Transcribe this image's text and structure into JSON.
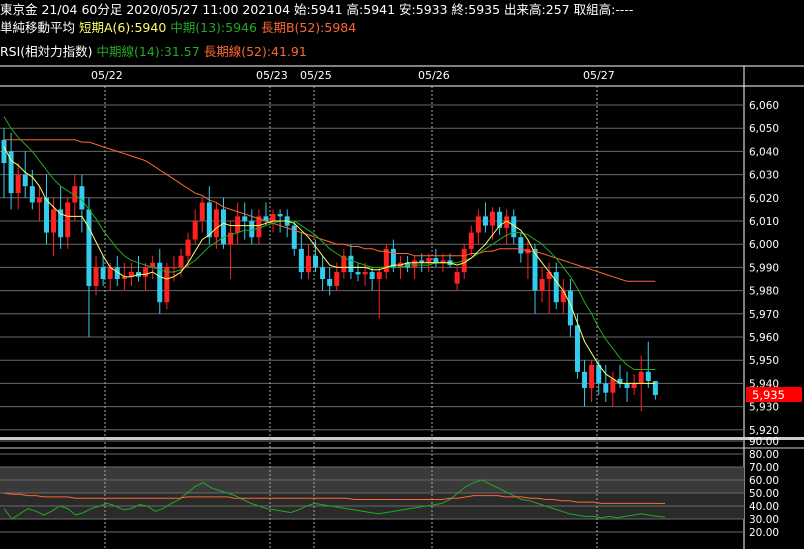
{
  "header": {
    "line1": "東京金 21/04 60分足 2020/05/27 11:00 202104 始:5941 高:5941 安:5933 終:5935 出来高:257 取組高:----",
    "ma_title": "単純移動平均",
    "ma_short": "短期A(6):5940",
    "ma_mid": "中期(13):5946",
    "ma_long": "長期B(52):5984",
    "rsi_title": "RSI(相対力指数)",
    "rsi_mid": "中期線(14):31.57",
    "rsi_long": "長期線(52):41.91"
  },
  "colors": {
    "up": "#ff2222",
    "down": "#33ccee",
    "ma_short": "#ffff66",
    "ma_mid": "#22aa22",
    "ma_long": "#ff6633",
    "last_price_bg": "#ff0000"
  },
  "chart_data": [
    {
      "type": "candlestick",
      "title": "東京金 21/04 60分足",
      "x_labels": [
        "05/22",
        "05/23",
        "05/25",
        "05/26",
        "05/27"
      ],
      "ylim": [
        5920,
        6070
      ],
      "y_ticks": [
        "6,060",
        "6,050",
        "6,040",
        "6,030",
        "6,020",
        "6,010",
        "6,000",
        "5,990",
        "5,980",
        "5,970",
        "5,960",
        "5,950",
        "5,940",
        "5,930",
        "5,920"
      ],
      "last_price_label": "5,935",
      "grid": true,
      "candles": [
        {
          "o": 6045,
          "h": 6050,
          "l": 6020,
          "c": 6035
        },
        {
          "o": 6040,
          "h": 6048,
          "l": 6015,
          "c": 6022
        },
        {
          "o": 6022,
          "h": 6035,
          "l": 6015,
          "c": 6030
        },
        {
          "o": 6030,
          "h": 6040,
          "l": 6020,
          "c": 6025
        },
        {
          "o": 6025,
          "h": 6032,
          "l": 6015,
          "c": 6018
        },
        {
          "o": 6018,
          "h": 6025,
          "l": 6010,
          "c": 6020
        },
        {
          "o": 6020,
          "h": 6030,
          "l": 6000,
          "c": 6005
        },
        {
          "o": 6005,
          "h": 6020,
          "l": 5995,
          "c": 6015
        },
        {
          "o": 6015,
          "h": 6025,
          "l": 5998,
          "c": 6003
        },
        {
          "o": 6003,
          "h": 6020,
          "l": 5998,
          "c": 6018
        },
        {
          "o": 6018,
          "h": 6030,
          "l": 6010,
          "c": 6025
        },
        {
          "o": 6025,
          "h": 6030,
          "l": 6005,
          "c": 6015
        },
        {
          "o": 6015,
          "h": 6020,
          "l": 5960,
          "c": 5982
        },
        {
          "o": 5982,
          "h": 5995,
          "l": 5978,
          "c": 5990
        },
        {
          "o": 5990,
          "h": 5995,
          "l": 5982,
          "c": 5985
        },
        {
          "o": 5985,
          "h": 5992,
          "l": 5980,
          "c": 5990
        },
        {
          "o": 5990,
          "h": 5995,
          "l": 5982,
          "c": 5985
        },
        {
          "o": 5985,
          "h": 5992,
          "l": 5980,
          "c": 5986
        },
        {
          "o": 5986,
          "h": 5992,
          "l": 5982,
          "c": 5988
        },
        {
          "o": 5988,
          "h": 5995,
          "l": 5984,
          "c": 5986
        },
        {
          "o": 5986,
          "h": 5992,
          "l": 5980,
          "c": 5990
        },
        {
          "o": 5990,
          "h": 5995,
          "l": 5985,
          "c": 5992
        },
        {
          "o": 5992,
          "h": 5998,
          "l": 5970,
          "c": 5975
        },
        {
          "o": 5975,
          "h": 5992,
          "l": 5972,
          "c": 5990
        },
        {
          "o": 5990,
          "h": 5995,
          "l": 5984,
          "c": 5990
        },
        {
          "o": 5990,
          "h": 5998,
          "l": 5986,
          "c": 5995
        },
        {
          "o": 5995,
          "h": 6005,
          "l": 5990,
          "c": 6002
        },
        {
          "o": 6002,
          "h": 6015,
          "l": 6000,
          "c": 6010
        },
        {
          "o": 6010,
          "h": 6020,
          "l": 6005,
          "c": 6018
        },
        {
          "o": 6018,
          "h": 6025,
          "l": 6000,
          "c": 6003
        },
        {
          "o": 6003,
          "h": 6018,
          "l": 5998,
          "c": 6015
        },
        {
          "o": 6015,
          "h": 6020,
          "l": 5998,
          "c": 6000
        },
        {
          "o": 6000,
          "h": 6010,
          "l": 5985,
          "c": 6005
        },
        {
          "o": 6005,
          "h": 6018,
          "l": 6000,
          "c": 6012
        },
        {
          "o": 6012,
          "h": 6018,
          "l": 6002,
          "c": 6010
        },
        {
          "o": 6010,
          "h": 6015,
          "l": 6000,
          "c": 6003
        },
        {
          "o": 6003,
          "h": 6015,
          "l": 6000,
          "c": 6012
        },
        {
          "o": 6012,
          "h": 6018,
          "l": 6008,
          "c": 6010
        },
        {
          "o": 6010,
          "h": 6015,
          "l": 6005,
          "c": 6013
        },
        {
          "o": 6013,
          "h": 6015,
          "l": 6005,
          "c": 6012
        },
        {
          "o": 6012,
          "h": 6015,
          "l": 6003,
          "c": 6008
        },
        {
          "o": 6008,
          "h": 6010,
          "l": 5995,
          "c": 5998
        },
        {
          "o": 5998,
          "h": 6005,
          "l": 5985,
          "c": 5988
        },
        {
          "o": 5988,
          "h": 6000,
          "l": 5985,
          "c": 5995
        },
        {
          "o": 5995,
          "h": 6002,
          "l": 5988,
          "c": 5990
        },
        {
          "o": 5990,
          "h": 5995,
          "l": 5980,
          "c": 5985
        },
        {
          "o": 5985,
          "h": 5990,
          "l": 5978,
          "c": 5982
        },
        {
          "o": 5982,
          "h": 5992,
          "l": 5980,
          "c": 5988
        },
        {
          "o": 5988,
          "h": 5998,
          "l": 5985,
          "c": 5995
        },
        {
          "o": 5995,
          "h": 6000,
          "l": 5985,
          "c": 5988
        },
        {
          "o": 5988,
          "h": 5992,
          "l": 5984,
          "c": 5987
        },
        {
          "o": 5987,
          "h": 5992,
          "l": 5982,
          "c": 5988
        },
        {
          "o": 5988,
          "h": 5990,
          "l": 5980,
          "c": 5985
        },
        {
          "o": 5985,
          "h": 5990,
          "l": 5968,
          "c": 5988
        },
        {
          "o": 5988,
          "h": 6000,
          "l": 5985,
          "c": 5998
        },
        {
          "o": 5998,
          "h": 6002,
          "l": 5988,
          "c": 5990
        },
        {
          "o": 5990,
          "h": 5995,
          "l": 5985,
          "c": 5992
        },
        {
          "o": 5992,
          "h": 5995,
          "l": 5988,
          "c": 5990
        },
        {
          "o": 5990,
          "h": 5995,
          "l": 5985,
          "c": 5993
        },
        {
          "o": 5993,
          "h": 5996,
          "l": 5988,
          "c": 5992
        },
        {
          "o": 5992,
          "h": 5996,
          "l": 5988,
          "c": 5994
        },
        {
          "o": 5994,
          "h": 5998,
          "l": 5990,
          "c": 5992
        },
        {
          "o": 5992,
          "h": 5996,
          "l": 5988,
          "c": 5993
        },
        {
          "o": 5993,
          "h": 5996,
          "l": 5990,
          "c": 5991
        },
        {
          "o": 5983,
          "h": 5990,
          "l": 5980,
          "c": 5988
        },
        {
          "o": 5988,
          "h": 6000,
          "l": 5985,
          "c": 5998
        },
        {
          "o": 5998,
          "h": 6008,
          "l": 5995,
          "c": 6005
        },
        {
          "o": 6005,
          "h": 6015,
          "l": 6000,
          "c": 6012
        },
        {
          "o": 6012,
          "h": 6018,
          "l": 6005,
          "c": 6008
        },
        {
          "o": 6008,
          "h": 6016,
          "l": 6002,
          "c": 6014
        },
        {
          "o": 6014,
          "h": 6016,
          "l": 6004,
          "c": 6007
        },
        {
          "o": 6007,
          "h": 6015,
          "l": 6000,
          "c": 6012
        },
        {
          "o": 6012,
          "h": 6015,
          "l": 6000,
          "c": 6003
        },
        {
          "o": 6003,
          "h": 6005,
          "l": 5992,
          "c": 5996
        },
        {
          "o": 5996,
          "h": 6002,
          "l": 5985,
          "c": 5998
        },
        {
          "o": 5998,
          "h": 6000,
          "l": 5970,
          "c": 5980
        },
        {
          "o": 5980,
          "h": 5990,
          "l": 5975,
          "c": 5985
        },
        {
          "o": 5985,
          "h": 5992,
          "l": 5970,
          "c": 5988
        },
        {
          "o": 5988,
          "h": 5992,
          "l": 5972,
          "c": 5975
        },
        {
          "o": 5975,
          "h": 5985,
          "l": 5970,
          "c": 5980
        },
        {
          "o": 5980,
          "h": 5985,
          "l": 5960,
          "c": 5965
        },
        {
          "o": 5965,
          "h": 5970,
          "l": 5942,
          "c": 5945
        },
        {
          "o": 5945,
          "h": 5950,
          "l": 5930,
          "c": 5938
        },
        {
          "o": 5938,
          "h": 5950,
          "l": 5932,
          "c": 5948
        },
        {
          "o": 5948,
          "h": 5950,
          "l": 5935,
          "c": 5940
        },
        {
          "o": 5940,
          "h": 5948,
          "l": 5932,
          "c": 5936
        },
        {
          "o": 5936,
          "h": 5945,
          "l": 5930,
          "c": 5942
        },
        {
          "o": 5942,
          "h": 5948,
          "l": 5938,
          "c": 5940
        },
        {
          "o": 5940,
          "h": 5945,
          "l": 5932,
          "c": 5938
        },
        {
          "o": 5938,
          "h": 5944,
          "l": 5935,
          "c": 5940
        },
        {
          "o": 5940,
          "h": 5952,
          "l": 5928,
          "c": 5945
        },
        {
          "o": 5945,
          "h": 5958,
          "l": 5938,
          "c": 5941
        },
        {
          "o": 5941,
          "h": 5941,
          "l": 5933,
          "c": 5935
        }
      ],
      "ma_short": [
        6042,
        6036,
        6034,
        6031,
        6029,
        6025,
        6019,
        6016,
        6013,
        6012,
        6012,
        6012,
        6007,
        6001,
        5995,
        5990,
        5988,
        5986,
        5986,
        5987,
        5987,
        5988,
        5986,
        5985,
        5986,
        5988,
        5992,
        5997,
        6002,
        6004,
        6007,
        6009,
        6008,
        6008,
        6008,
        6008,
        6008,
        6009,
        6010,
        6010,
        6010,
        6009,
        6006,
        6003,
        5999,
        5995,
        5991,
        5990,
        5990,
        5990,
        5990,
        5990,
        5989,
        5989,
        5990,
        5991,
        5991,
        5992,
        5992,
        5992,
        5992,
        5992,
        5992,
        5992,
        5991,
        5992,
        5994,
        5997,
        6000,
        6004,
        6008,
        6010,
        6008,
        6006,
        6002,
        5996,
        5992,
        5988,
        5984,
        5980,
        5974,
        5966,
        5958,
        5953,
        5948,
        5944,
        5942,
        5940,
        5940,
        5940,
        5940,
        5940,
        5940
      ],
      "ma_mid": [
        6055,
        6050,
        6046,
        6043,
        6040,
        6036,
        6032,
        6028,
        6025,
        6023,
        6021,
        6019,
        6015,
        6011,
        6006,
        6002,
        5998,
        5995,
        5993,
        5992,
        5991,
        5990,
        5989,
        5988,
        5988,
        5989,
        5991,
        5993,
        5996,
        5999,
        6001,
        6003,
        6004,
        6005,
        6006,
        6006,
        6007,
        6008,
        6009,
        6010,
        6010,
        6010,
        6008,
        6006,
        6004,
        6001,
        5998,
        5996,
        5994,
        5993,
        5992,
        5991,
        5990,
        5990,
        5990,
        5990,
        5990,
        5991,
        5991,
        5991,
        5991,
        5992,
        5992,
        5992,
        5992,
        5993,
        5994,
        5996,
        5998,
        6000,
        6002,
        6004,
        6005,
        6005,
        6004,
        6002,
        6000,
        5997,
        5994,
        5990,
        5986,
        5981,
        5975,
        5970,
        5964,
        5959,
        5955,
        5951,
        5948,
        5946,
        5946,
        5946,
        5946
      ],
      "ma_long": [
        6045,
        6045,
        6045,
        6045,
        6045,
        6045,
        6045,
        6045,
        6045,
        6045,
        6045,
        6044,
        6044,
        6043,
        6042,
        6041,
        6040,
        6039,
        6038,
        6037,
        6036,
        6034,
        6032,
        6030,
        6028,
        6026,
        6024,
        6022,
        6021,
        6019,
        6018,
        6016,
        6015,
        6014,
        6013,
        6012,
        6011,
        6010,
        6009,
        6008,
        6007,
        6006,
        6005,
        6004,
        6003,
        6002,
        6001,
        6000,
        6000,
        5999,
        5999,
        5998,
        5998,
        5997,
        5997,
        5996,
        5996,
        5996,
        5995,
        5995,
        5995,
        5995,
        5995,
        5995,
        5995,
        5995,
        5996,
        5996,
        5997,
        5997,
        5998,
        5998,
        5998,
        5998,
        5997,
        5997,
        5996,
        5995,
        5994,
        5993,
        5992,
        5991,
        5990,
        5989,
        5988,
        5987,
        5986,
        5985,
        5984,
        5984,
        5984,
        5984,
        5984
      ]
    },
    {
      "type": "line",
      "title": "RSI(相対力指数)",
      "ylim": [
        20,
        90
      ],
      "y_ticks": [
        "90.00",
        "80.00",
        "70.00",
        "60.00",
        "50.00",
        "40.00",
        "30.00",
        "20.00"
      ],
      "series": [
        {
          "name": "中期線(14)",
          "color": "#22aa22",
          "values": [
            38,
            30,
            34,
            38,
            36,
            33,
            36,
            40,
            38,
            33,
            35,
            38,
            40,
            42,
            40,
            37,
            38,
            41,
            40,
            36,
            38,
            42,
            45,
            50,
            55,
            58,
            54,
            52,
            50,
            48,
            45,
            42,
            40,
            38,
            37,
            36,
            35,
            37,
            40,
            42,
            41,
            40,
            39,
            38,
            37,
            36,
            35,
            34,
            35,
            36,
            37,
            38,
            39,
            40,
            41,
            42,
            45,
            50,
            55,
            58,
            60,
            57,
            54,
            51,
            48,
            45,
            44,
            42,
            40,
            38,
            36,
            34,
            33,
            32,
            32,
            31,
            32,
            31,
            32,
            33,
            34,
            33,
            32,
            31.57
          ]
        },
        {
          "name": "長期線(52)",
          "color": "#ff6633",
          "values": [
            50,
            49,
            49,
            48,
            48,
            47,
            47,
            47,
            47,
            46,
            46,
            46,
            46,
            46,
            46,
            46,
            46,
            46,
            46,
            46,
            46,
            46,
            46,
            47,
            47,
            47,
            47,
            47,
            47,
            46,
            46,
            46,
            46,
            46,
            46,
            46,
            46,
            46,
            46,
            46,
            46,
            46,
            46,
            46,
            45,
            45,
            45,
            45,
            45,
            45,
            45,
            45,
            45,
            45,
            45,
            45,
            46,
            46,
            47,
            48,
            48,
            48,
            48,
            47,
            47,
            47,
            46,
            46,
            45,
            45,
            44,
            44,
            43,
            43,
            43,
            42,
            42,
            42,
            42,
            42,
            42,
            42,
            42,
            41.91
          ]
        }
      ]
    }
  ]
}
